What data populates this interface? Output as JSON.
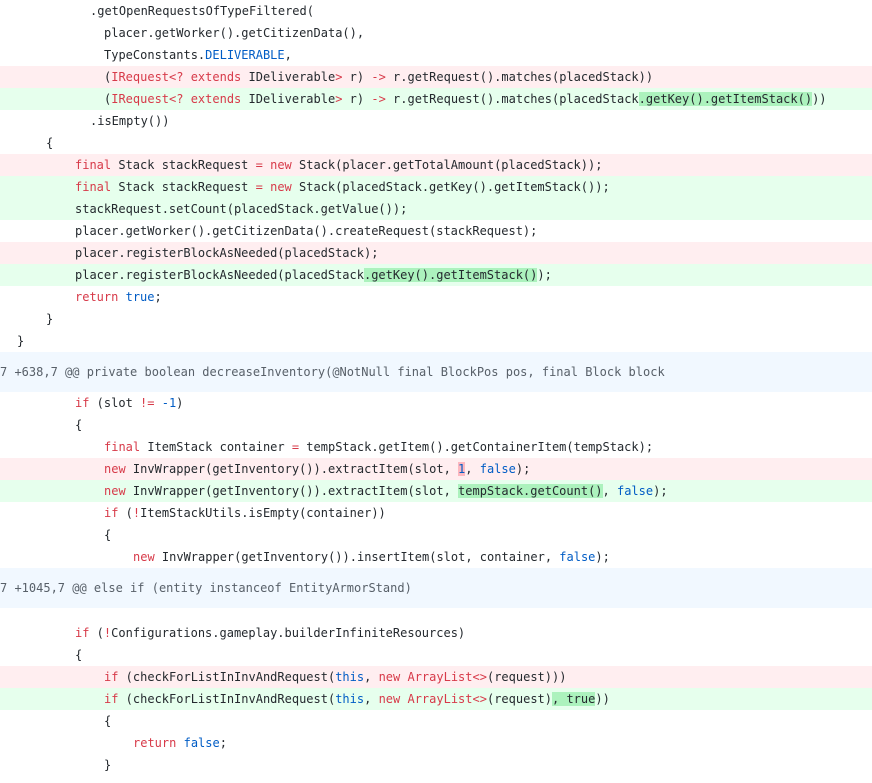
{
  "diff": {
    "colors": {
      "deleted_line": "#ffeef0",
      "added_line": "#e6ffed",
      "hunk_header": "#f1f8ff",
      "keyword": "#d73a49",
      "constant": "#005cc5",
      "added_highlight": "#acf2bd",
      "deleted_highlight": "#fdb8c0"
    },
    "hunk1_lines": {
      "l1": ".getOpenRequestsOfTypeFiltered(",
      "l2": "placer.getWorker().getCitizenData(),",
      "l3a": "TypeConstants.",
      "l3b": "DELIVERABLE",
      "l3c": ",",
      "l4": {
        "a": "(",
        "b": "IRequest<? extends",
        "c": " IDeliverable",
        "d": ">",
        "e": " r) ",
        "f": "->",
        "g": " r.getRequest().matches(placedStack))"
      },
      "l5": {
        "a": "(",
        "b": "IRequest<? extends",
        "c": " IDeliverable",
        "d": ">",
        "e": " r) ",
        "f": "->",
        "g": " r.getRequest().matches(placedStack",
        "h": ".getKey().getItemStack()",
        "i": "))"
      },
      "l6": ".isEmpty())",
      "l7": "{",
      "l8": {
        "a": "final",
        "b": " Stack stackRequest ",
        "c": "=",
        "d": " ",
        "e": "new",
        "f": " Stack(placer.getTotalAmount(placedStack));"
      },
      "l9": {
        "a": "final",
        "b": " Stack stackRequest ",
        "c": "=",
        "d": " ",
        "e": "new",
        "f": " Stack(placedStack.getKey().getItemStack());"
      },
      "l10": "stackRequest.setCount(placedStack.getValue());",
      "l11": "placer.getWorker().getCitizenData().createRequest(stackRequest);",
      "l12": "placer.registerBlockAsNeeded(placedStack);",
      "l13": {
        "a": "placer.registerBlockAsNeeded(placedStack",
        "b": ".getKey().getItemStack()",
        "c": ");"
      },
      "l14": {
        "a": "return",
        "b": " ",
        "c": "true",
        "d": ";"
      },
      "l15": "}",
      "l16": "}"
    },
    "hunk2_header": "7 +638,7 @@ private boolean decreaseInventory(@NotNull final BlockPos pos, final Block block",
    "hunk2_lines": {
      "l1": {
        "a": "if",
        "b": " (slot ",
        "c": "!=",
        "d": " ",
        "e": "-1",
        "f": ")"
      },
      "l2": "{",
      "l3": {
        "a": "final",
        "b": " ItemStack container ",
        "c": "=",
        "d": " tempStack.getItem().getContainerItem(tempStack);"
      },
      "l4": {
        "a": "new",
        "b": " InvWrapper(getInventory()).extractItem(slot, ",
        "c": "1",
        "d": ", ",
        "e": "false",
        "f": ");"
      },
      "l5": {
        "a": "new",
        "b": " InvWrapper(getInventory()).extractItem(slot, ",
        "c": "tempStack.getCount()",
        "d": ", ",
        "e": "false",
        "f": ");"
      },
      "l6": {
        "a": "if",
        "b": " (",
        "c": "!",
        "d": "ItemStackUtils.isEmpty(container))"
      },
      "l7": "{",
      "l8": {
        "a": "new",
        "b": " InvWrapper(getInventory()).insertItem(slot, container, ",
        "c": "false",
        "d": ");"
      }
    },
    "hunk3_header": "7 +1045,7 @@ else if (entity instanceof EntityArmorStand)",
    "hunk3_lines": {
      "l1": {
        "a": "if",
        "b": " (",
        "c": "!",
        "d": "Configurations.gameplay.builderInfiniteResources)"
      },
      "l2": "{",
      "l3": {
        "a": "if",
        "b": " (checkForListInInvAndRequest(",
        "c": "this",
        "d": ", ",
        "e": "new",
        "f": " ",
        "g": "ArrayList<>",
        "h": "(request)))"
      },
      "l4": {
        "a": "if",
        "b": " (checkForListInInvAndRequest(",
        "c": "this",
        "d": ", ",
        "e": "new",
        "f": " ",
        "g": "ArrayList<>",
        "h": "(request)",
        "i": ", true",
        "j": "))"
      },
      "l5": "{",
      "l6": {
        "a": "return",
        "b": " ",
        "c": "false",
        "d": ";"
      },
      "l7": "}"
    }
  }
}
